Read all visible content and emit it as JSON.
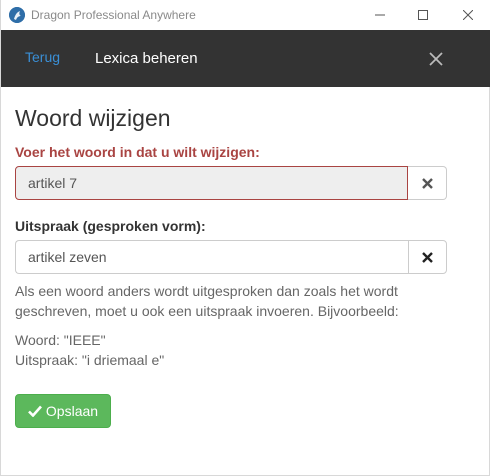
{
  "window": {
    "title": "Dragon Professional Anywhere"
  },
  "header": {
    "back_label": "Terug",
    "title": "Lexica beheren"
  },
  "form": {
    "heading": "Woord wijzigen",
    "word_label": "Voer het woord in dat u wilt wijzigen:",
    "word_value": "artikel 7",
    "pronunciation_label": "Uitspraak (gesproken vorm):",
    "pronunciation_value": "artikel zeven",
    "help_text": "Als een woord anders wordt uitgesproken dan zoals het wordt geschreven, moet u ook een uitspraak invoeren. Bijvoorbeeld:",
    "example_word": "Woord: \"IEEE\"",
    "example_pronunciation": "Uitspraak: \"i driemaal e\"",
    "save_label": "Opslaan"
  },
  "colors": {
    "header_bg": "#333333",
    "link": "#3a8fd6",
    "error": "#a94442",
    "success": "#5cb85c"
  },
  "icons": {
    "app": "dragon-logo-icon",
    "minimize": "minimize-icon",
    "maximize": "maximize-icon",
    "close": "close-icon",
    "clear": "clear-x-icon",
    "save": "checkmark-icon"
  }
}
